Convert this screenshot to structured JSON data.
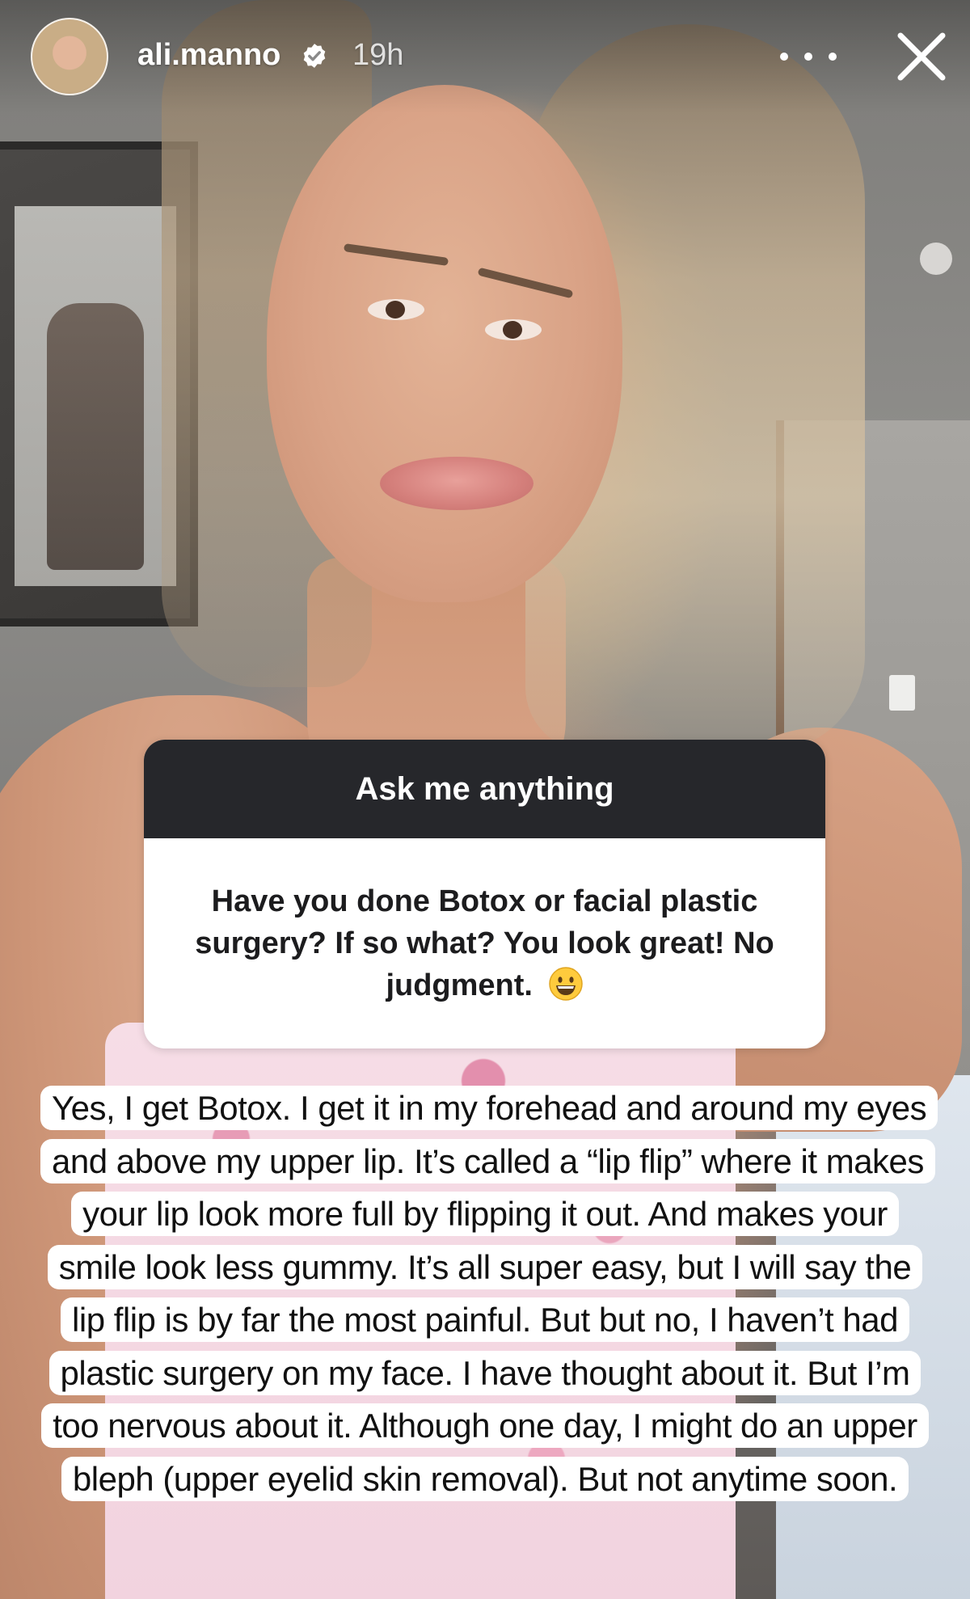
{
  "story": {
    "username": "ali.manno",
    "timestamp": "19h",
    "verified": true
  },
  "icons": {
    "verified": "verified-badge-icon",
    "more": "more-horizontal-icon",
    "close": "close-icon",
    "emoji": "grinning-face-emoji"
  },
  "question_sticker": {
    "header": "Ask me anything",
    "question": "Have you done Botox or facial plastic surgery? If so what? You look great! No judgment."
  },
  "answer": {
    "text": "Yes, I get Botox. I get it in my forehead and around my eyes and above my upper lip. It’s called a “lip flip” where it makes your lip look more full by flipping it out. And makes your smile look less gummy. It’s all super easy, but I will say the lip flip is by far the most painful. But but no, I haven’t had plastic surgery on my face. I have thought about it. But I’m too nervous about it. Although one day, I might do an upper bleph (upper eyelid skin removal). But not anytime soon."
  },
  "colors": {
    "sticker_header_bg": "#26272b",
    "sticker_text": "#1c1c1e",
    "answer_bg": "#ffffff",
    "overlay_text": "#ffffff"
  }
}
